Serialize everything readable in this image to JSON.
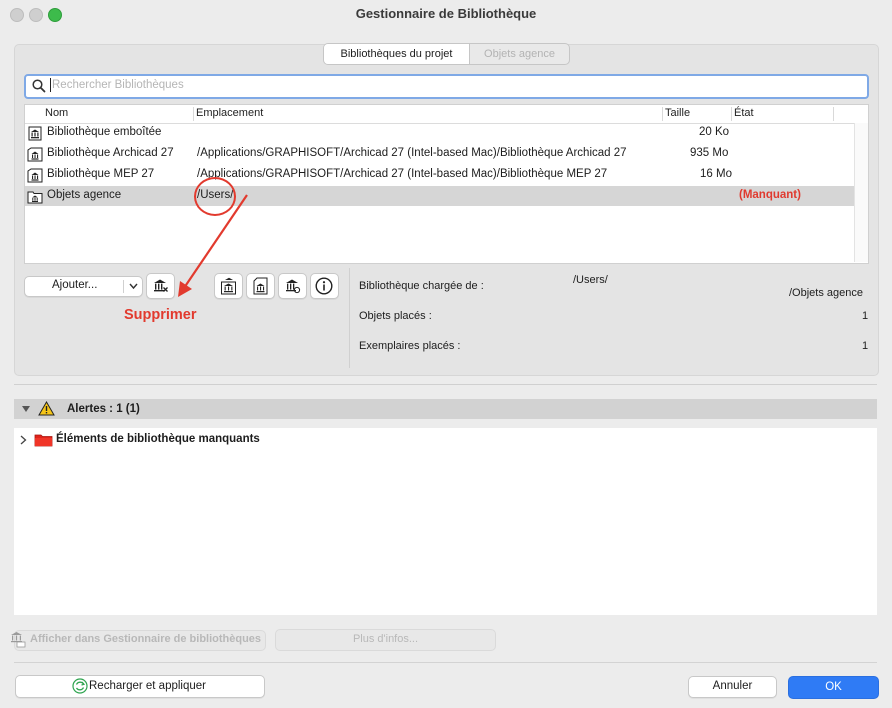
{
  "window": {
    "title": "Gestionnaire de Bibliothèque",
    "traffic_lights": {
      "close": "#cfcfcf",
      "minimize": "#cfcfcf",
      "zoom": "#3dbb4b"
    }
  },
  "tabs": [
    {
      "label": "Bibliothèques du projet",
      "selected": true
    },
    {
      "label": "Objets agence",
      "selected": false
    }
  ],
  "search": {
    "placeholder": "Rechercher Bibliothèques",
    "icon": "search-icon"
  },
  "table": {
    "columns": [
      "Nom",
      "Emplacement",
      "Taille",
      "État"
    ],
    "rows": [
      {
        "icon": "embedded-library-icon",
        "name": "Bibliothèque emboîtée",
        "location": "",
        "size": "20 Ko",
        "state": ""
      },
      {
        "icon": "library-file-icon",
        "name": "Bibliothèque Archicad 27",
        "location": "/Applications/GRAPHISOFT/Archicad 27 (Intel-based Mac)/Bibliothèque Archicad 27",
        "size": "935 Mo",
        "state": ""
      },
      {
        "icon": "library-file-icon",
        "name": "Bibliothèque MEP 27",
        "location": "/Applications/GRAPHISOFT/Archicad 27 (Intel-based Mac)/Bibliothèque MEP 27",
        "size": "16 Mo",
        "state": ""
      },
      {
        "icon": "library-folder-icon",
        "name": "Objets agence",
        "location": "/Users/",
        "size": "",
        "state": "(Manquant)",
        "selected": true
      }
    ]
  },
  "toolbar": {
    "add_label": "Ajouter...",
    "delete_icon": "remove-library-icon",
    "icons": [
      "library-settings-icon",
      "library-document-icon",
      "library-sync-icon",
      "info-icon"
    ]
  },
  "annotation": {
    "label": "Supprimer",
    "color": "#e23a2e"
  },
  "details": {
    "loaded_from_label": "Bibliothèque chargée de :",
    "loaded_from_value_line1": "/Users/",
    "loaded_from_value_line2": "/Objets agence",
    "placed_objects_label": "Objets placés :",
    "placed_objects_value": "1",
    "placed_instances_label": "Exemplaires placés :",
    "placed_instances_value": "1"
  },
  "alerts": {
    "header": "Alertes : 1 (1)",
    "items": [
      {
        "label": "Éléments de bibliothèque manquants",
        "icon": "red-folder-icon"
      }
    ]
  },
  "footer": {
    "show_in_manager": "Afficher dans Gestionnaire de bibliothèques",
    "more_info": "Plus d'infos...",
    "reload_apply": "Recharger et appliquer",
    "cancel": "Annuler",
    "ok": "OK"
  }
}
